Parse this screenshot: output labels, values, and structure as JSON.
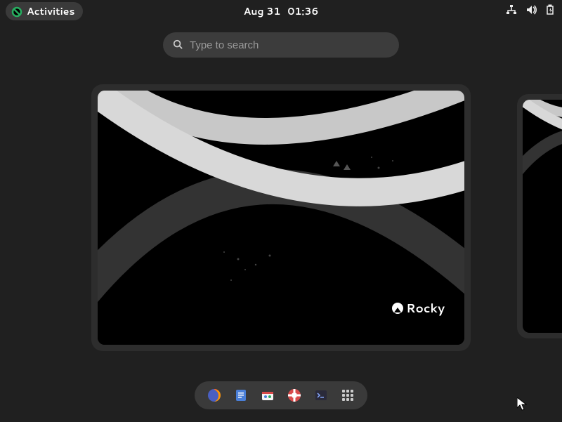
{
  "topbar": {
    "activities_label": "Activities",
    "date": "Aug 31",
    "time": "01:36"
  },
  "search": {
    "placeholder": "Type to search",
    "value": ""
  },
  "workspace": {
    "wallpaper_name": "Rocky"
  },
  "tray": {
    "network_icon": "network-wired",
    "volume_icon": "volume-high",
    "power_icon": "battery-charging"
  },
  "dash": {
    "items": [
      {
        "name": "firefox",
        "label": "Firefox"
      },
      {
        "name": "notes",
        "label": "Notes"
      },
      {
        "name": "software",
        "label": "Software"
      },
      {
        "name": "help",
        "label": "Help"
      },
      {
        "name": "terminal",
        "label": "Terminal"
      },
      {
        "name": "apps",
        "label": "Show Applications"
      }
    ]
  },
  "colors": {
    "bg": "#202020",
    "panel": "#3a3a3a",
    "accent_green": "#27ae60"
  }
}
